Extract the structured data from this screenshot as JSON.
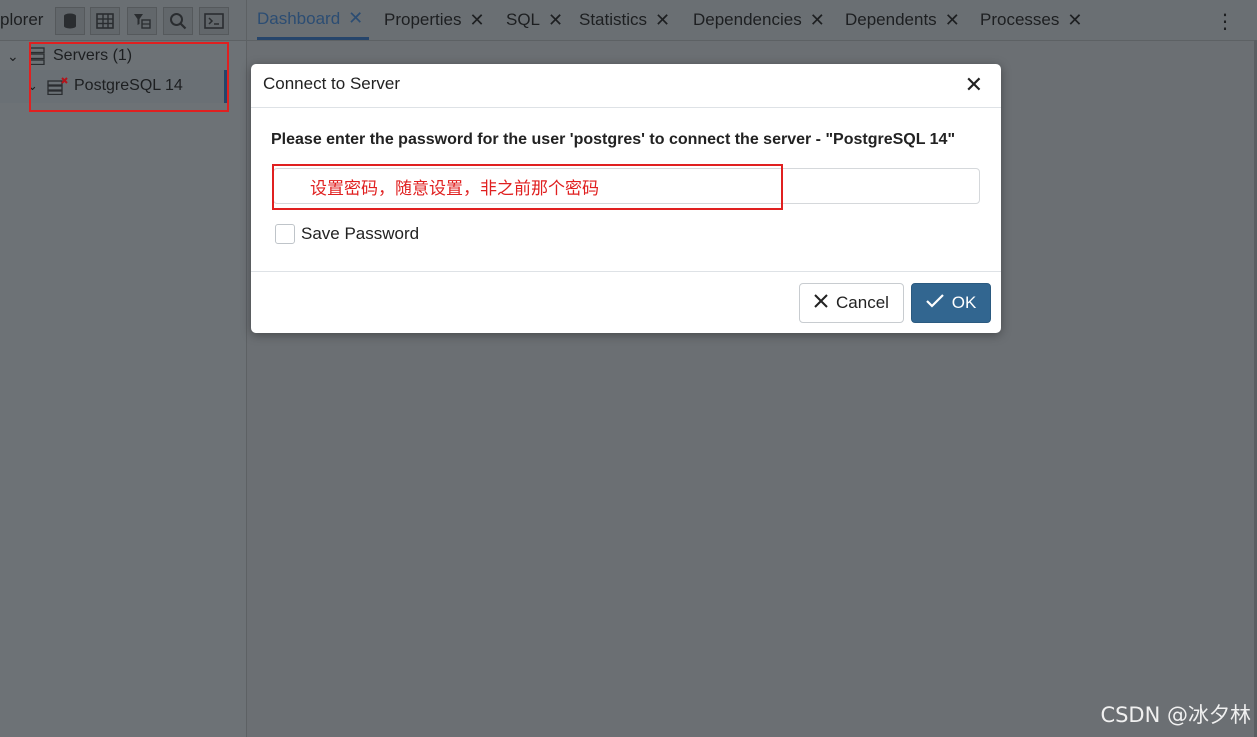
{
  "explorer": {
    "label": "plorer",
    "tree": {
      "servers_label": "Servers (1)",
      "server_item": "PostgreSQL 14"
    }
  },
  "tabs": [
    {
      "label": "Dashboard",
      "active": true
    },
    {
      "label": "Properties"
    },
    {
      "label": "SQL"
    },
    {
      "label": "Statistics"
    },
    {
      "label": "Dependencies"
    },
    {
      "label": "Dependents"
    },
    {
      "label": "Processes"
    }
  ],
  "tab_close_glyph": "✕",
  "kebab_glyph": "⋮",
  "dialog": {
    "title": "Connect to Server",
    "close_glyph": "✕",
    "prompt": "Please enter the password for the user 'postgres' to connect the server - \"PostgreSQL 14\"",
    "password_value": "",
    "annotation": "设置密码，随意设置，非之前那个密码",
    "save_password_label": "Save Password",
    "save_password_checked": false,
    "cancel_label": "Cancel",
    "ok_label": "OK"
  },
  "watermark": "CSDN @冰夕林",
  "colors": {
    "accent": "#326690",
    "annotation_red": "#e02020",
    "overlay": "#6b6f73"
  }
}
